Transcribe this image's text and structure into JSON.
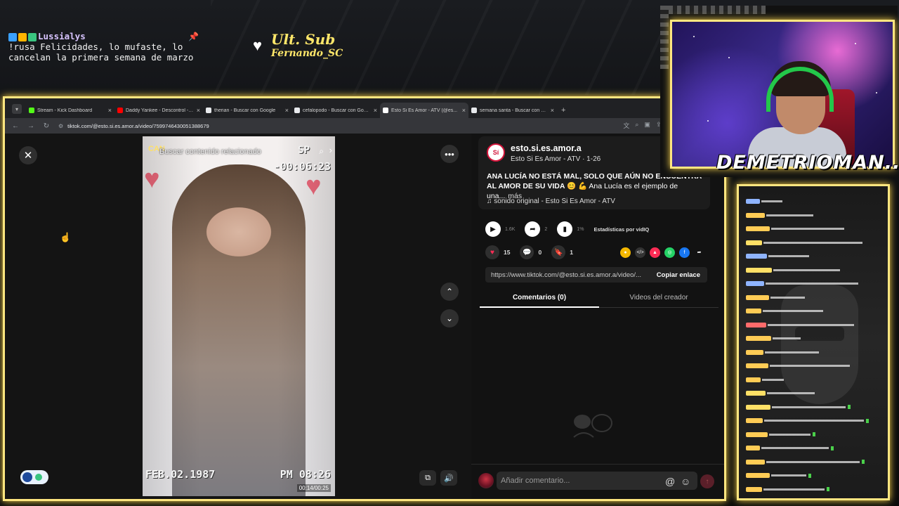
{
  "stream": {
    "banner": {
      "user": "Lussialys",
      "message": "!rusa Felicidades, lo mufaste, lo cancelan la primera semana de marzo"
    },
    "ult_sub": {
      "title": "Ult. Sub",
      "name": "Fernando_SC"
    },
    "streamer_name": "DEMETRIOMAN",
    "streamer_suffix": "...",
    "chat": [
      {
        "user": "",
        "text": "",
        "color": "#8fb4ff"
      },
      {
        "user": "",
        "text": "",
        "color": "#ffcc55"
      },
      {
        "user": "",
        "text": "",
        "color": "#ffcc55"
      },
      {
        "user": "",
        "text": "",
        "color": "#ffe066"
      },
      {
        "user": "",
        "text": "",
        "color": "#8fb4ff"
      },
      {
        "user": "",
        "text": "",
        "color": "#ffe066"
      },
      {
        "user": "",
        "text": "",
        "color": "#8fb4ff"
      },
      {
        "user": "",
        "text": "",
        "color": "#ffcc55"
      },
      {
        "user": "",
        "text": "",
        "color": "#ffcc55"
      },
      {
        "user": "",
        "text": "",
        "color": "#ff6b6b"
      },
      {
        "user": "",
        "text": "",
        "color": "#ffcc55"
      },
      {
        "user": "",
        "text": "",
        "color": "#ffcc55"
      },
      {
        "user": "",
        "text": "",
        "color": "#ffcc55"
      },
      {
        "user": "",
        "text": "",
        "color": "#ffcc55"
      },
      {
        "user": "",
        "text": "",
        "color": "#ffe066"
      },
      {
        "user": "",
        "text": "",
        "color": "#ffe066"
      },
      {
        "user": "",
        "text": "",
        "color": "#ffcc55"
      },
      {
        "user": "",
        "text": "",
        "color": "#ffcc55"
      },
      {
        "user": "",
        "text": "",
        "color": "#ffcc55"
      },
      {
        "user": "",
        "text": "",
        "color": "#ffcc55"
      },
      {
        "user": "",
        "text": "",
        "color": "#ffcc55"
      },
      {
        "user": "",
        "text": "",
        "color": "#ffcc55"
      }
    ]
  },
  "browser": {
    "tabs": [
      {
        "label": "Stream - Kick Dashboard",
        "fav_color": "#53fc18",
        "active": false
      },
      {
        "label": "Daddy Yankee - Descontrol - Yo...",
        "fav_color": "#ff0000",
        "active": false
      },
      {
        "label": "therian - Buscar con Google",
        "fav_color": "#e8eaed",
        "active": false
      },
      {
        "label": "cefalopodo - Buscar con Google",
        "fav_color": "#e8eaed",
        "active": false
      },
      {
        "label": "Esto Si Es Amor - ATV (@es...",
        "fav_color": "#ffffff",
        "active": true
      },
      {
        "label": "semana santa - Buscar con Goo...",
        "fav_color": "#e8eaed",
        "active": false
      }
    ],
    "url": "tiktok.com/@esto.si.es.amor.a/video/7599746430051388679"
  },
  "video": {
    "related": "Buscar contenido relacionado",
    "channel_logo": "CAN",
    "sp_label": "SP",
    "counter": "-00:06:23",
    "date": "FEB.02.1987",
    "clock": "PM 08:26",
    "time": "00:14/00:25"
  },
  "post": {
    "avatar_text": "Sí",
    "handle": "esto.si.es.amor.a",
    "meta": "Esto Si Es Amor - ATV · 1-26",
    "desc_bold": "ANA LUCÍA NO ESTÁ MAL, SOLO QUE AÚN NO ENCUENTRA AL AMOR DE SU VIDA",
    "desc_rest": "😊 💪 Ana Lucía es el ejemplo de una...",
    "more": "más",
    "sound": "sonido original - Esto Si Es Amor - ATV",
    "stats": {
      "plays": "1.6K",
      "shares_views": "2",
      "pct": "1%",
      "vidiq": "Estadísticas por vidIQ"
    },
    "likes": "15",
    "comments": "0",
    "saves": "1",
    "link": "https://www.tiktok.com/@esto.si.es.amor.a/video/...",
    "copy_label": "Copiar enlace",
    "tab_comments": "Comentarios (0)",
    "tab_creator": "Videos del creador",
    "comment_placeholder": "Añadir comentario..."
  }
}
